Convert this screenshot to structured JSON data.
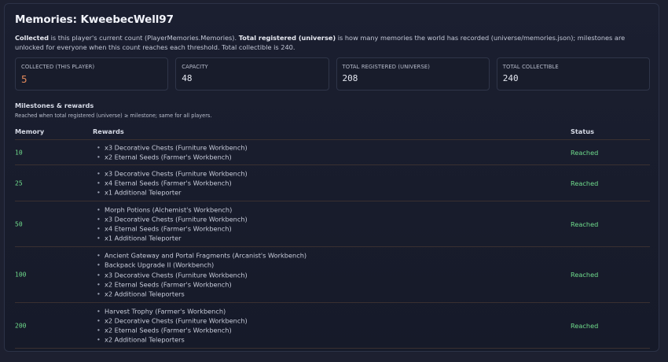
{
  "title": "Memories: KweebecWell97",
  "description": {
    "collected_term": "Collected",
    "collected_text": " is this player's current count (PlayerMemories.Memories). ",
    "total_term": "Total registered (universe)",
    "total_text": " is how many memories the world has recorded (universe/memories.json); milestones are unlocked for everyone when this count reaches each threshold. Total collectible is 240."
  },
  "stats": [
    {
      "label": "Collected (this player)",
      "value": "5"
    },
    {
      "label": "Capacity",
      "value": "48"
    },
    {
      "label": "Total registered (universe)",
      "value": "208"
    },
    {
      "label": "Total collectible",
      "value": "240"
    }
  ],
  "milestones": {
    "title": "Milestones & rewards",
    "subtitle": "Reached when total registered (universe) ≥ milestone; same for all players.",
    "columns": {
      "memory": "Memory",
      "rewards": "Rewards",
      "status": "Status"
    },
    "rows": [
      {
        "memory": "10",
        "rewards": [
          "x3 Decorative Chests (Furniture Workbench)",
          "x2 Eternal Seeds (Farmer's Workbench)"
        ],
        "status": "Reached"
      },
      {
        "memory": "25",
        "rewards": [
          "x3 Decorative Chests (Furniture Workbench)",
          "x4 Eternal Seeds (Farmer's Workbench)",
          "x1 Additional Teleporter"
        ],
        "status": "Reached"
      },
      {
        "memory": "50",
        "rewards": [
          "Morph Potions (Alchemist's Workbench)",
          "x3 Decorative Chests (Furniture Workbench)",
          "x4 Eternal Seeds (Farmer's Workbench)",
          "x1 Additional Teleporter"
        ],
        "status": "Reached"
      },
      {
        "memory": "100",
        "rewards": [
          "Ancient Gateway and Portal Fragments (Arcanist's Workbench)",
          "Backpack Upgrade II (Workbench)",
          "x3 Decorative Chests (Furniture Workbench)",
          "x2 Eternal Seeds (Farmer's Workbench)",
          "x2 Additional Teleporters"
        ],
        "status": "Reached"
      },
      {
        "memory": "200",
        "rewards": [
          "Harvest Trophy (Farmer's Workbench)",
          "x2 Decorative Chests (Furniture Workbench)",
          "x2 Eternal Seeds (Farmer's Workbench)",
          "x2 Additional Teleporters"
        ],
        "status": "Reached"
      }
    ]
  },
  "colors": {
    "background": "#1d2030",
    "accent_collected": "#e48a5c",
    "reached": "#6fdc8c",
    "row_divider": "#3a3030"
  }
}
